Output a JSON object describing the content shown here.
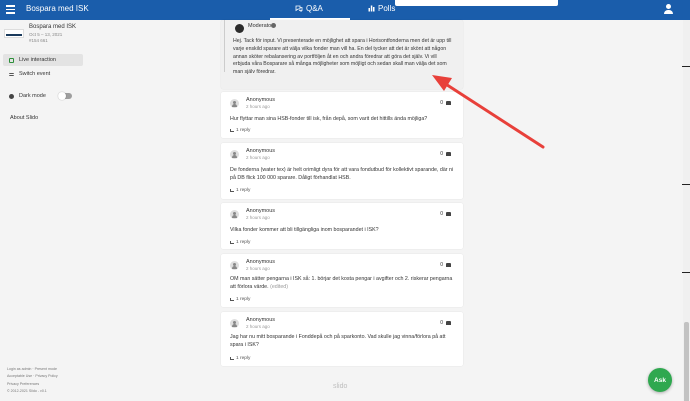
{
  "topbar": {
    "event_title": "Bospara med ISK",
    "tabs": [
      {
        "label": "Q&A"
      },
      {
        "label": "Polls"
      }
    ]
  },
  "sidebar": {
    "event_name": "Bospara med ISK",
    "event_dates": "Oct 5 – 13, 2021",
    "event_code": "#154 661",
    "items": [
      {
        "label": "Live interaction"
      },
      {
        "label": "Switch event"
      },
      {
        "label": "Dark mode"
      }
    ],
    "about": "About Slido",
    "footer": [
      "Login as admin · Present mode",
      "Acceptable Use · Privacy Policy",
      "Privacy Preferences",
      "© 2012-2021 Slido - v0.1"
    ]
  },
  "moderator_answer": {
    "author": "Moderator",
    "text": "Hej. Tack för input. Vi presenterade en möjlighet att spara i Horisontfonderna men det är upp till varje enskild sparare att välja vilka fonder man vill ha. En del tycker att det är skönt att någon annan sköter rebalansering av portföljen åt en och andra föredrar att göra det själv. Vi vill erbjuda våra Bosparare så många möjligheter som möjligt och sedan skall man välja det som man själv föredrar."
  },
  "questions": [
    {
      "author": "Anonymous",
      "time": "2 hours ago",
      "likes": "0",
      "text": "Hur flyttar man sina HSB-fonder till isk, från depå, som varit det hittills ända möjliga?",
      "edited": "",
      "reply": "1 reply"
    },
    {
      "author": "Anonymous",
      "time": "2 hours ago",
      "likes": "0",
      "text": "De fonderna (water tex) är helt orimligt dyra för att vara fondutbud för kollektivt sparande, där ni på DB flick 100 000 sparare. Dåligt förhandlat HSB.",
      "edited": "",
      "reply": "1 reply"
    },
    {
      "author": "Anonymous",
      "time": "2 hours ago",
      "likes": "0",
      "text": "Vilka fonder kommer att bli tillgängliga inom bosparandet i ISK?",
      "edited": "",
      "reply": "1 reply"
    },
    {
      "author": "Anonymous",
      "time": "2 hours ago",
      "likes": "0",
      "text": "OM man sätter pengarna i ISK så: 1. börjar det kosta pengar i avgifter och 2. riskerar pengarna att förlora värde.",
      "edited": "(edited)",
      "reply": "1 reply"
    },
    {
      "author": "Anonymous",
      "time": "2 hours ago",
      "likes": "0",
      "text": "Jag har nu mitt bosparande i Fonddepå och på sparkonto. Vad skulle jag vinna/förlora på att spara i ISK?",
      "edited": "",
      "reply": "1 reply"
    }
  ],
  "brand": "slido",
  "ask_button": "Ask",
  "colors": {
    "topbar": "#1a5dab",
    "ask": "#2fa84f",
    "arrow": "#e8403a"
  }
}
